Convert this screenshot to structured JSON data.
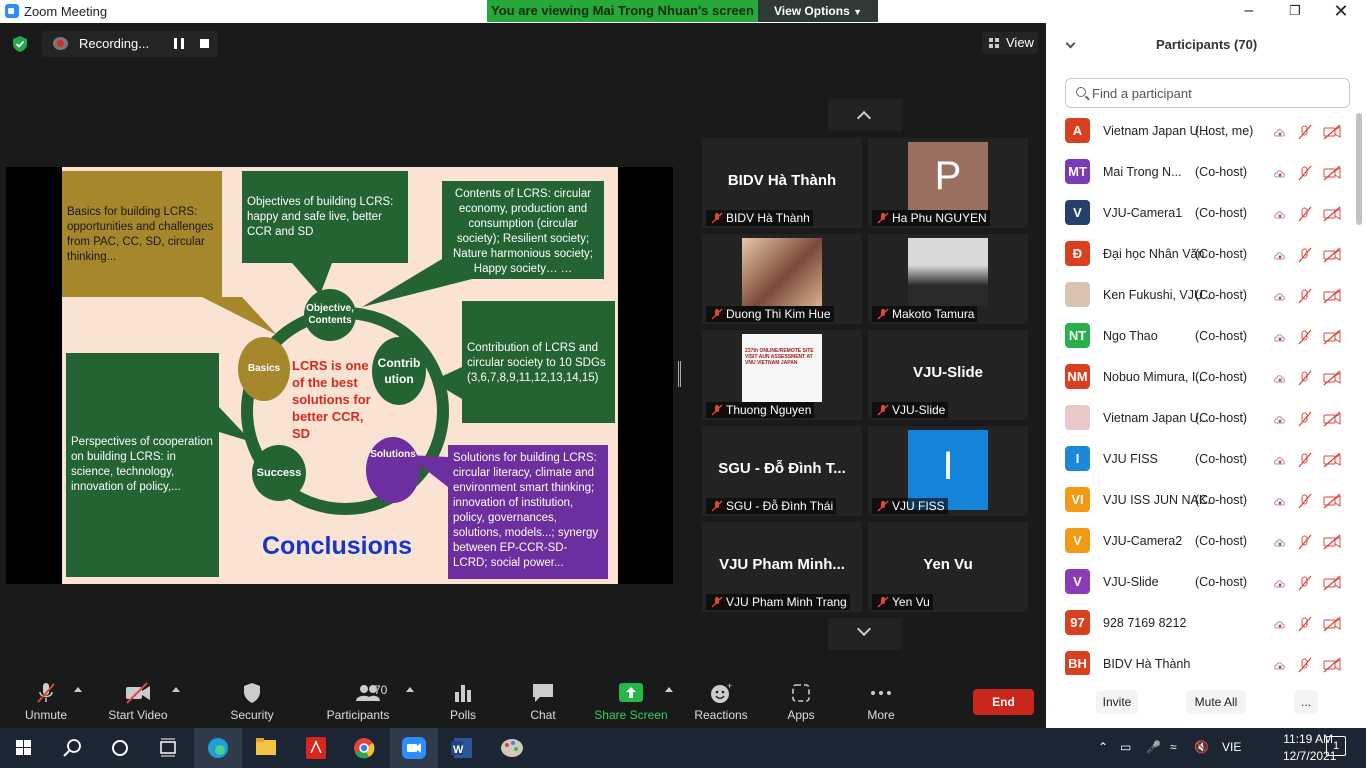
{
  "window": {
    "title": "Zoom Meeting"
  },
  "banner": {
    "viewing": "You are viewing Mai Trong Nhuan's screen",
    "view_options": "View Options"
  },
  "recording": {
    "label": "Recording..."
  },
  "view_button": {
    "label": "View"
  },
  "slide": {
    "basics_box": "Basics for building LCRS: opportunities and challenges from PAC, CC, SD, circular thinking...",
    "objectives_box": "Objectives of building LCRS: happy and safe live, better CCR and SD",
    "contents_box": "Contents of LCRS: circular economy, production and consumption (circular society); Resilient society; Nature harmonious society; Happy society… …",
    "contribution_box": "Contribution of LCRS and circular society to 10 SDGs (3,6,7,8,9,11,12,13,14,15)",
    "perspectives_box": "Perspectives of cooperation on building LCRS: in science, technology, innovation of policy,...",
    "solutions_box": "Solutions for building LCRS: circular literacy, climate and environment smart thinking; innovation of institution, policy, governances, solutions, models...; synergy between EP-CCR-SD- LCRD; social power...",
    "node_objective": "Objective, Contents",
    "node_basics": "Basics",
    "node_contribution": "Contrib ution",
    "node_success": "Success",
    "node_solutions": "Solutions",
    "center_text": "LCRS is one of the best solutions for better CCR, SD",
    "conclusions": "Conclusions"
  },
  "tiles": [
    {
      "big": "BIDV Hà Thành",
      "label": "BIDV Hà Thành"
    },
    {
      "big": "P",
      "label": "Ha Phu NGUYEN"
    },
    {
      "big": "",
      "label": "Duong Thi Kim Hue"
    },
    {
      "big": "",
      "label": "Makoto Tamura"
    },
    {
      "big": "",
      "label": "Thuong Nguyen"
    },
    {
      "big": "VJU-Slide",
      "label": "VJU-Slide"
    },
    {
      "big": "SGU - Đỗ Đình T...",
      "label": "SGU - Đỗ Đình Thái"
    },
    {
      "big": "I",
      "label": "VJU FISS"
    },
    {
      "big": "VJU Pham Minh...",
      "label": "VJU Pham Minh Trang"
    },
    {
      "big": "Yen Vu",
      "label": "Yen Vu"
    }
  ],
  "thumb_text": "237th ONLINE/REMOTE SITE VISIT AUN ASSESSMENT AT VNU VIETNAM JAPAN",
  "toolbar": {
    "unmute": "Unmute",
    "start_video": "Start Video",
    "security": "Security",
    "participants": "Participants",
    "participants_count": "70",
    "polls": "Polls",
    "chat": "Chat",
    "share_screen": "Share Screen",
    "reactions": "Reactions",
    "apps": "Apps",
    "more": "More",
    "end": "End"
  },
  "panel": {
    "title": "Participants (70)",
    "search_placeholder": "Find a participant",
    "participants": [
      {
        "initials": "A",
        "color": "#d9401f",
        "name": "Vietnam Japan U...",
        "role": "(Host, me)"
      },
      {
        "initials": "MT",
        "color": "#7a3bb8",
        "name": "Mai Trong N...",
        "role": "(Co-host)"
      },
      {
        "initials": "V",
        "color": "#26406e",
        "name": "VJU-Camera1",
        "role": "(Co-host)"
      },
      {
        "initials": "Đ",
        "color": "#d9401f",
        "name": "Đại học Nhân Văn",
        "role": "(Co-host)"
      },
      {
        "initials": "",
        "color": "#d8c4b0",
        "name": "Ken Fukushi, VJU ...",
        "role": "(Co-host)"
      },
      {
        "initials": "NT",
        "color": "#27b04b",
        "name": "Ngo Thao",
        "role": "(Co-host)"
      },
      {
        "initials": "NM",
        "color": "#d9401f",
        "name": "Nobuo Mimura, I...",
        "role": "(Co-host)"
      },
      {
        "initials": "",
        "color": "#e8c8c8",
        "name": "Vietnam Japan U...",
        "role": "(Co-host)"
      },
      {
        "initials": "I",
        "color": "#1e88d8",
        "name": "VJU FISS",
        "role": "(Co-host)"
      },
      {
        "initials": "VI",
        "color": "#f29a16",
        "name": "VJU ISS JUN NAK...",
        "role": "(Co-host)"
      },
      {
        "initials": "V",
        "color": "#f29a16",
        "name": "VJU-Camera2",
        "role": "(Co-host)"
      },
      {
        "initials": "V",
        "color": "#8a3bb8",
        "name": "VJU-Slide",
        "role": "(Co-host)"
      },
      {
        "initials": "97",
        "color": "#d9401f",
        "name": "928 7169 8212",
        "role": ""
      },
      {
        "initials": "BH",
        "color": "#d9401f",
        "name": "BIDV Hà Thành",
        "role": ""
      }
    ],
    "invite": "Invite",
    "mute_all": "Mute All",
    "more": "..."
  },
  "taskbar": {
    "lang": "VIE",
    "time": "11:19 AM",
    "date": "12/7/2021",
    "notif": "1"
  }
}
